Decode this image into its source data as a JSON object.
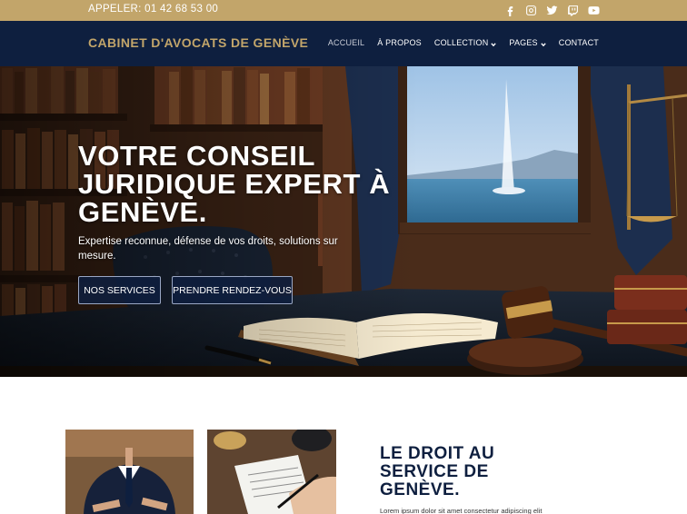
{
  "topbar": {
    "phone": "APPELER: 01 42 68 53 00",
    "social": [
      "facebook-icon",
      "instagram-icon",
      "twitter-icon",
      "twitch-icon",
      "youtube-icon"
    ]
  },
  "header": {
    "brand": "CABINET D'AVOCATS DE GENÈVE",
    "nav": [
      {
        "label": "ACCUEIL",
        "active": true,
        "dropdown": false
      },
      {
        "label": "À PROPOS",
        "active": false,
        "dropdown": false
      },
      {
        "label": "COLLECTION",
        "active": false,
        "dropdown": true
      },
      {
        "label": "PAGES",
        "active": false,
        "dropdown": true
      },
      {
        "label": "CONTACT",
        "active": false,
        "dropdown": false
      }
    ]
  },
  "hero": {
    "title": "VOTRE CONSEIL JURIDIQUE EXPERT À GENÈVE.",
    "subtitle": "Expertise reconnue, défense de vos droits, solutions sur mesure.",
    "primary_button": "NOS SERVICES",
    "secondary_button": "PRENDRE RENDEZ-VOUS"
  },
  "section": {
    "title": "LE DROIT AU SERVICE DE GENÈVE.",
    "text": "Lorem ipsum dolor sit amet consectetur adipiscing elit"
  },
  "colors": {
    "accent_gold": "#c2a56a",
    "navy": "#0e1f3f"
  }
}
